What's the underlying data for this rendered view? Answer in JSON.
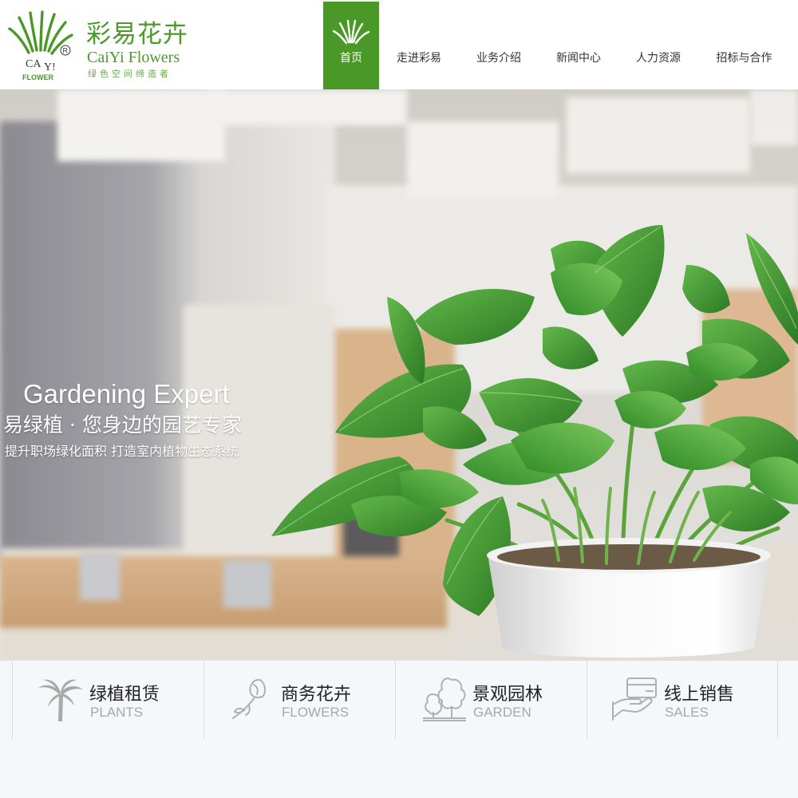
{
  "brand": {
    "name_cn": "彩易花卉",
    "name_en": "CaiYi Flowers",
    "slogan": "绿色空间缔造者",
    "mark_text": "CA Y!",
    "mark_sub": "FLOWER",
    "registered": "®",
    "color": "#4a9827"
  },
  "nav": {
    "items": [
      {
        "label": "首页",
        "active": true
      },
      {
        "label": "走进彩易"
      },
      {
        "label": "业务介绍"
      },
      {
        "label": "新闻中心"
      },
      {
        "label": "人力资源"
      },
      {
        "label": "招标与合作"
      }
    ]
  },
  "banner": {
    "title": "Gardening Expert",
    "subtitle": "易绿植 · 您身边的园艺专家",
    "description": "提升职场绿化面积 打造室内植物生态系统"
  },
  "services": [
    {
      "cn": "绿植租赁",
      "en": "PLANTS",
      "icon": "palm-tree-icon"
    },
    {
      "cn": "商务花卉",
      "en": "FLOWERS",
      "icon": "rose-icon"
    },
    {
      "cn": "景观园林",
      "en": "GARDEN",
      "icon": "garden-trees-icon"
    },
    {
      "cn": "线上销售",
      "en": "SALES",
      "icon": "card-hand-icon"
    }
  ]
}
